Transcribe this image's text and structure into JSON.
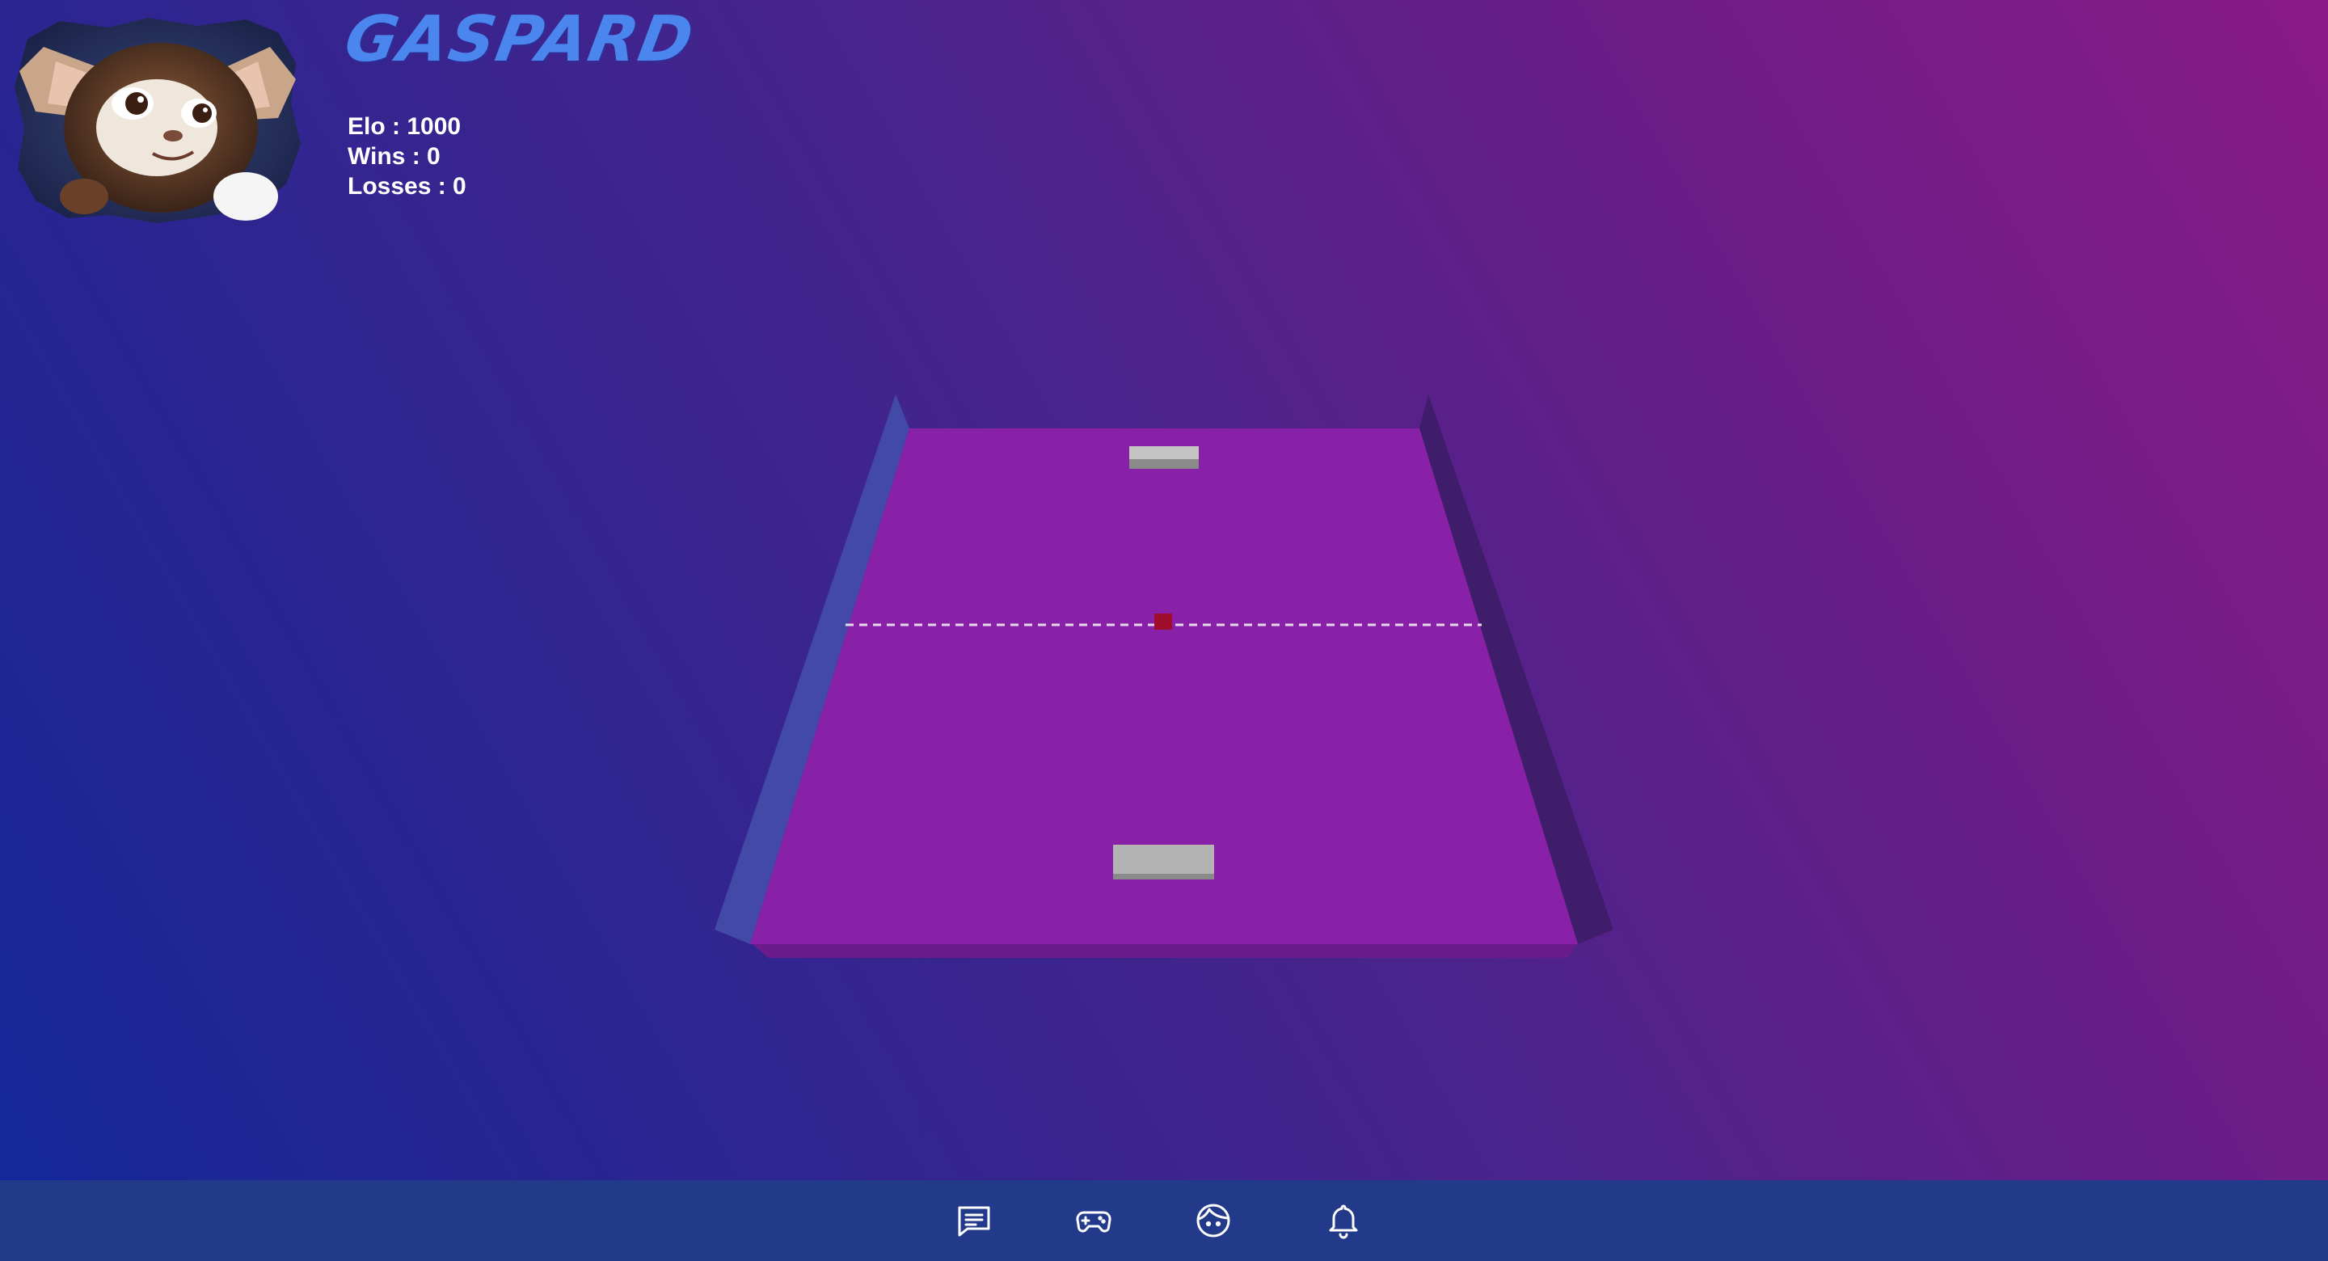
{
  "player": {
    "name": "GASPARD",
    "elo_label": "Elo : 1000",
    "wins_label": "Wins : 0",
    "losses_label": "Losses : 0"
  },
  "game": {
    "table_color": "#8920a8",
    "left_wall_color": "#4349a6",
    "right_wall_color": "#3f1d6a",
    "paddle_color": "#b3b3b3",
    "ball_color": "#9e0e2a",
    "net_style": "dashed"
  },
  "navbar": {
    "background": "#233a8a",
    "items": [
      {
        "icon": "chat-icon"
      },
      {
        "icon": "gamepad-icon"
      },
      {
        "icon": "face-icon"
      },
      {
        "icon": "bell-icon"
      }
    ]
  }
}
